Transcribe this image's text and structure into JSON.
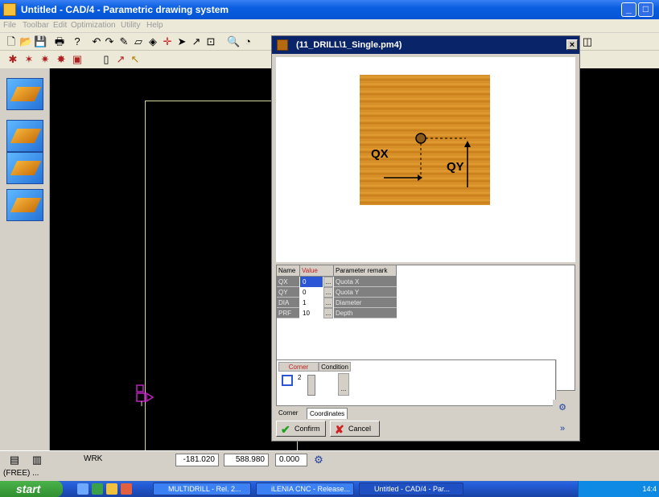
{
  "window": {
    "title": "Untitled - CAD/4 - Parametric drawing system",
    "min_glyph": "_",
    "max_glyph": "□",
    "close_glyph": "×"
  },
  "menu": [
    "File",
    "Toolbar",
    "Edit",
    "Optimization",
    "Utility",
    "Help"
  ],
  "toolbar1_icons": [
    "new-icon",
    "open-icon",
    "save-icon",
    "print-icon",
    "help-icon",
    "undo-icon",
    "redo-icon",
    "draw-icon",
    "eraser-icon",
    "snap-icon",
    "crosshair-icon",
    "pointer-icon",
    "measure-icon",
    "zoom-window-icon",
    "zoom-in-icon",
    "zoom-out-icon"
  ],
  "toolbar2_icons": [
    "tool-a-icon",
    "tool-b-icon",
    "tool-c-icon",
    "tool-d-icon",
    "tool-e-icon",
    "tool-f-icon",
    "tool-g-icon",
    "tool-h-icon"
  ],
  "palette": [
    "macro-block-icon",
    "drill-top-icon",
    "drill-side-icon",
    "pocket-icon"
  ],
  "dialog": {
    "title": "(11_DRILL\\1_Single.pm4)",
    "close_glyph": "×",
    "image_labels": {
      "qx": "QX",
      "qy": "QY"
    },
    "table_headers": {
      "name": "Name",
      "value": "Value",
      "remark": "Parameter remark"
    },
    "params": [
      {
        "name": "QX",
        "value": "0",
        "remark": "Quota X",
        "selected": true
      },
      {
        "name": "QY",
        "value": "0",
        "remark": "Quota Y",
        "selected": false
      },
      {
        "name": "DIA",
        "value": "1",
        "remark": "Diameter",
        "selected": false
      },
      {
        "name": "PRF",
        "value": "10",
        "remark": "Depth",
        "selected": false
      }
    ],
    "dots": "...",
    "corner_headers": {
      "corner": "Corner",
      "condition": "Condition"
    },
    "corner_value": "2",
    "tabs": [
      "Corner",
      "Coordinates"
    ],
    "confirm_label": "Confirm",
    "cancel_label": "Cancel",
    "side_btn_1": "⚙",
    "side_btn_2": "»"
  },
  "statusbar": {
    "mode": "WRK",
    "x": "-181.020",
    "y": "588.980",
    "z": "0.000"
  },
  "free_label": "(FREE) ...",
  "taskbar": {
    "start": "start",
    "items": [
      "MULTIDRILL - Rel. 2...",
      "iLENIA CNC - Release...",
      "Untitled - CAD/4 - Par..."
    ],
    "clock": "14:4"
  }
}
